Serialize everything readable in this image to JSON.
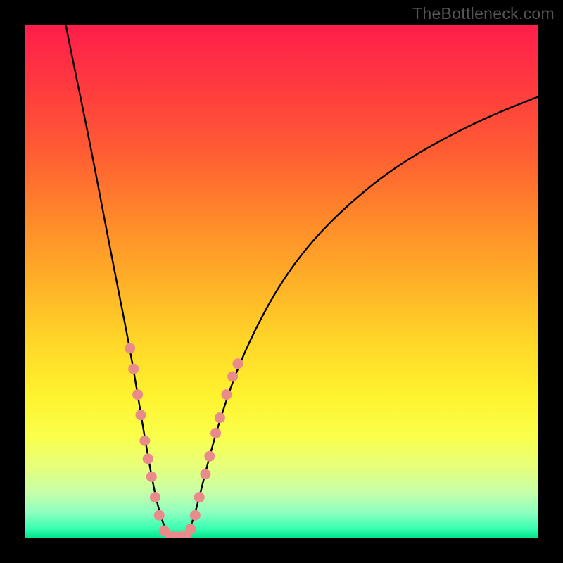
{
  "watermark": "TheBottleneck.com",
  "chart_data": {
    "type": "line",
    "title": "",
    "xlabel": "",
    "ylabel": "",
    "xlim": [
      0,
      100
    ],
    "ylim": [
      0,
      100
    ],
    "notes": "V-shaped bottleneck curve on a color gradient from red (high mismatch) through yellow to green (optimal). No visible axis ticks or numeric labels. Pink markers highlight data points along the lower portion of the V near the minimum.",
    "curve": [
      {
        "x": 8.0,
        "y": 100.0
      },
      {
        "x": 10.0,
        "y": 90.0
      },
      {
        "x": 12.5,
        "y": 78.0
      },
      {
        "x": 15.0,
        "y": 65.0
      },
      {
        "x": 17.5,
        "y": 52.0
      },
      {
        "x": 19.5,
        "y": 42.0
      },
      {
        "x": 21.0,
        "y": 34.0
      },
      {
        "x": 22.5,
        "y": 25.0
      },
      {
        "x": 24.0,
        "y": 16.0
      },
      {
        "x": 25.5,
        "y": 8.0
      },
      {
        "x": 27.0,
        "y": 2.5
      },
      {
        "x": 28.5,
        "y": 0.3
      },
      {
        "x": 31.0,
        "y": 0.3
      },
      {
        "x": 32.5,
        "y": 2.5
      },
      {
        "x": 34.0,
        "y": 8.0
      },
      {
        "x": 36.0,
        "y": 16.0
      },
      {
        "x": 38.0,
        "y": 23.0
      },
      {
        "x": 41.0,
        "y": 32.0
      },
      {
        "x": 45.0,
        "y": 41.0
      },
      {
        "x": 50.0,
        "y": 50.0
      },
      {
        "x": 56.0,
        "y": 58.0
      },
      {
        "x": 63.0,
        "y": 65.0
      },
      {
        "x": 71.0,
        "y": 71.5
      },
      {
        "x": 80.0,
        "y": 77.0
      },
      {
        "x": 90.0,
        "y": 82.0
      },
      {
        "x": 100.0,
        "y": 86.0
      }
    ],
    "markers": [
      {
        "x": 20.5,
        "y": 37.0
      },
      {
        "x": 21.2,
        "y": 33.0
      },
      {
        "x": 22.0,
        "y": 28.0
      },
      {
        "x": 22.6,
        "y": 24.0
      },
      {
        "x": 23.4,
        "y": 19.0
      },
      {
        "x": 24.0,
        "y": 15.5
      },
      {
        "x": 24.7,
        "y": 12.0
      },
      {
        "x": 25.4,
        "y": 8.0
      },
      {
        "x": 26.2,
        "y": 4.5
      },
      {
        "x": 27.2,
        "y": 1.5
      },
      {
        "x": 28.3,
        "y": 0.4
      },
      {
        "x": 29.3,
        "y": 0.3
      },
      {
        "x": 30.3,
        "y": 0.3
      },
      {
        "x": 31.3,
        "y": 0.5
      },
      {
        "x": 32.3,
        "y": 1.8
      },
      {
        "x": 33.2,
        "y": 4.5
      },
      {
        "x": 34.0,
        "y": 8.0
      },
      {
        "x": 35.2,
        "y": 12.5
      },
      {
        "x": 36.0,
        "y": 16.0
      },
      {
        "x": 37.2,
        "y": 20.5
      },
      {
        "x": 38.0,
        "y": 23.5
      },
      {
        "x": 39.3,
        "y": 28.0
      },
      {
        "x": 40.5,
        "y": 31.5
      },
      {
        "x": 41.5,
        "y": 34.0
      }
    ],
    "marker_color": "#e98b8b",
    "curve_color": "#000000"
  }
}
